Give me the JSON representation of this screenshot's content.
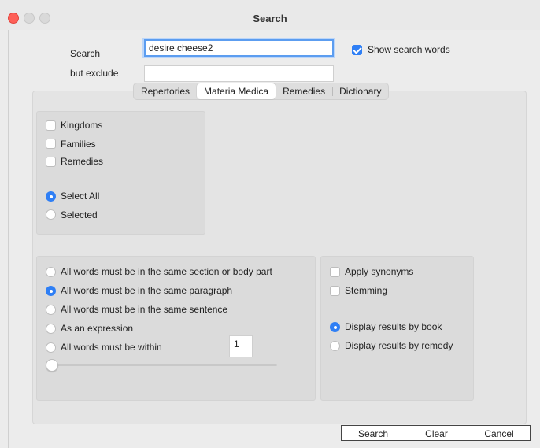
{
  "window": {
    "title": "Search"
  },
  "form": {
    "search_label": "Search",
    "search_value": "desire cheese2",
    "show_words_label": "Show search words",
    "show_words_checked": true,
    "exclude_label": "but exclude",
    "exclude_value": ""
  },
  "tabs": [
    {
      "label": "Repertories",
      "selected": false
    },
    {
      "label": "Materia Medica",
      "selected": true
    },
    {
      "label": "Remedies",
      "selected": false
    },
    {
      "label": "Dictionary",
      "selected": false
    }
  ],
  "scope": {
    "kingdoms": "Kingdoms",
    "families": "Families",
    "remedies": "Remedies",
    "select_all": "Select All",
    "selected": "Selected"
  },
  "matching": {
    "options": [
      {
        "label": "All words must be in the same section or body part",
        "checked": false
      },
      {
        "label": "All words must be in the same paragraph",
        "checked": true
      },
      {
        "label": "All words must be in the same sentence",
        "checked": false
      },
      {
        "label": "As an expression",
        "checked": false
      },
      {
        "label": "All words must be within",
        "checked": false
      }
    ],
    "within_value": "1",
    "slider_value": 0
  },
  "options": {
    "apply_synonyms": "Apply synonyms",
    "stemming": "Stemming",
    "display_by_book": "Display results by book",
    "display_by_remedy": "Display results by remedy"
  },
  "buttons": {
    "search": "Search",
    "clear": "Clear",
    "cancel": "Cancel"
  }
}
